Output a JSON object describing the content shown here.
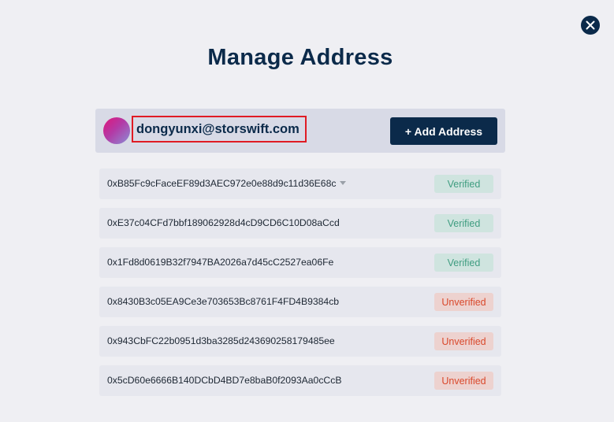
{
  "title": "Manage Address",
  "account": {
    "email": "dongyunxi@storswift.com",
    "add_button_label": "+ Add Address"
  },
  "addresses": [
    {
      "address": "0xB85Fc9cFaceEF89d3AEC972e0e88d9c11d36E68c",
      "status": "Verified"
    },
    {
      "address": "0xE37c04CFd7bbf189062928d4cD9CD6C10D08aCcd",
      "status": "Verified"
    },
    {
      "address": "0x1Fd8d0619B32f7947BA2026a7d45cC2527ea06Fe",
      "status": "Verified"
    },
    {
      "address": "0x8430B3c05EA9Ce3e703653Bc8761F4FD4B9384cb",
      "status": "Unverified"
    },
    {
      "address": "0x943CbFC22b0951d3ba3285d243690258179485ee",
      "status": "Unverified"
    },
    {
      "address": "0x5cD60e6666B140DCbD4BD7e8baB0f2093Aa0cCcB",
      "status": "Unverified"
    }
  ],
  "icons": {
    "close": "close-icon",
    "dropdown": "caret-down-icon"
  },
  "colors": {
    "primary": "#0b2a4a",
    "verified_text": "#3f9d80",
    "verified_bg": "#cfe4df",
    "unverified_text": "#d9482b",
    "unverified_bg": "#edd2cf",
    "highlight_border": "#e01b24"
  }
}
